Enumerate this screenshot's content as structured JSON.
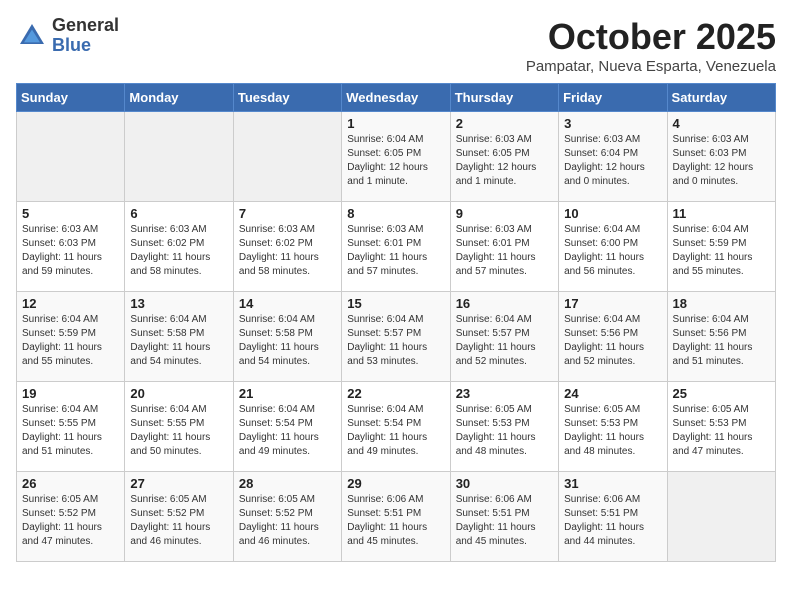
{
  "logo": {
    "general": "General",
    "blue": "Blue"
  },
  "title": "October 2025",
  "subtitle": "Pampatar, Nueva Esparta, Venezuela",
  "days_of_week": [
    "Sunday",
    "Monday",
    "Tuesday",
    "Wednesday",
    "Thursday",
    "Friday",
    "Saturday"
  ],
  "weeks": [
    [
      {
        "day": "",
        "info": ""
      },
      {
        "day": "",
        "info": ""
      },
      {
        "day": "",
        "info": ""
      },
      {
        "day": "1",
        "info": "Sunrise: 6:04 AM\nSunset: 6:05 PM\nDaylight: 12 hours\nand 1 minute."
      },
      {
        "day": "2",
        "info": "Sunrise: 6:03 AM\nSunset: 6:05 PM\nDaylight: 12 hours\nand 1 minute."
      },
      {
        "day": "3",
        "info": "Sunrise: 6:03 AM\nSunset: 6:04 PM\nDaylight: 12 hours\nand 0 minutes."
      },
      {
        "day": "4",
        "info": "Sunrise: 6:03 AM\nSunset: 6:03 PM\nDaylight: 12 hours\nand 0 minutes."
      }
    ],
    [
      {
        "day": "5",
        "info": "Sunrise: 6:03 AM\nSunset: 6:03 PM\nDaylight: 11 hours\nand 59 minutes."
      },
      {
        "day": "6",
        "info": "Sunrise: 6:03 AM\nSunset: 6:02 PM\nDaylight: 11 hours\nand 58 minutes."
      },
      {
        "day": "7",
        "info": "Sunrise: 6:03 AM\nSunset: 6:02 PM\nDaylight: 11 hours\nand 58 minutes."
      },
      {
        "day": "8",
        "info": "Sunrise: 6:03 AM\nSunset: 6:01 PM\nDaylight: 11 hours\nand 57 minutes."
      },
      {
        "day": "9",
        "info": "Sunrise: 6:03 AM\nSunset: 6:01 PM\nDaylight: 11 hours\nand 57 minutes."
      },
      {
        "day": "10",
        "info": "Sunrise: 6:04 AM\nSunset: 6:00 PM\nDaylight: 11 hours\nand 56 minutes."
      },
      {
        "day": "11",
        "info": "Sunrise: 6:04 AM\nSunset: 5:59 PM\nDaylight: 11 hours\nand 55 minutes."
      }
    ],
    [
      {
        "day": "12",
        "info": "Sunrise: 6:04 AM\nSunset: 5:59 PM\nDaylight: 11 hours\nand 55 minutes."
      },
      {
        "day": "13",
        "info": "Sunrise: 6:04 AM\nSunset: 5:58 PM\nDaylight: 11 hours\nand 54 minutes."
      },
      {
        "day": "14",
        "info": "Sunrise: 6:04 AM\nSunset: 5:58 PM\nDaylight: 11 hours\nand 54 minutes."
      },
      {
        "day": "15",
        "info": "Sunrise: 6:04 AM\nSunset: 5:57 PM\nDaylight: 11 hours\nand 53 minutes."
      },
      {
        "day": "16",
        "info": "Sunrise: 6:04 AM\nSunset: 5:57 PM\nDaylight: 11 hours\nand 52 minutes."
      },
      {
        "day": "17",
        "info": "Sunrise: 6:04 AM\nSunset: 5:56 PM\nDaylight: 11 hours\nand 52 minutes."
      },
      {
        "day": "18",
        "info": "Sunrise: 6:04 AM\nSunset: 5:56 PM\nDaylight: 11 hours\nand 51 minutes."
      }
    ],
    [
      {
        "day": "19",
        "info": "Sunrise: 6:04 AM\nSunset: 5:55 PM\nDaylight: 11 hours\nand 51 minutes."
      },
      {
        "day": "20",
        "info": "Sunrise: 6:04 AM\nSunset: 5:55 PM\nDaylight: 11 hours\nand 50 minutes."
      },
      {
        "day": "21",
        "info": "Sunrise: 6:04 AM\nSunset: 5:54 PM\nDaylight: 11 hours\nand 49 minutes."
      },
      {
        "day": "22",
        "info": "Sunrise: 6:04 AM\nSunset: 5:54 PM\nDaylight: 11 hours\nand 49 minutes."
      },
      {
        "day": "23",
        "info": "Sunrise: 6:05 AM\nSunset: 5:53 PM\nDaylight: 11 hours\nand 48 minutes."
      },
      {
        "day": "24",
        "info": "Sunrise: 6:05 AM\nSunset: 5:53 PM\nDaylight: 11 hours\nand 48 minutes."
      },
      {
        "day": "25",
        "info": "Sunrise: 6:05 AM\nSunset: 5:53 PM\nDaylight: 11 hours\nand 47 minutes."
      }
    ],
    [
      {
        "day": "26",
        "info": "Sunrise: 6:05 AM\nSunset: 5:52 PM\nDaylight: 11 hours\nand 47 minutes."
      },
      {
        "day": "27",
        "info": "Sunrise: 6:05 AM\nSunset: 5:52 PM\nDaylight: 11 hours\nand 46 minutes."
      },
      {
        "day": "28",
        "info": "Sunrise: 6:05 AM\nSunset: 5:52 PM\nDaylight: 11 hours\nand 46 minutes."
      },
      {
        "day": "29",
        "info": "Sunrise: 6:06 AM\nSunset: 5:51 PM\nDaylight: 11 hours\nand 45 minutes."
      },
      {
        "day": "30",
        "info": "Sunrise: 6:06 AM\nSunset: 5:51 PM\nDaylight: 11 hours\nand 45 minutes."
      },
      {
        "day": "31",
        "info": "Sunrise: 6:06 AM\nSunset: 5:51 PM\nDaylight: 11 hours\nand 44 minutes."
      },
      {
        "day": "",
        "info": ""
      }
    ]
  ]
}
